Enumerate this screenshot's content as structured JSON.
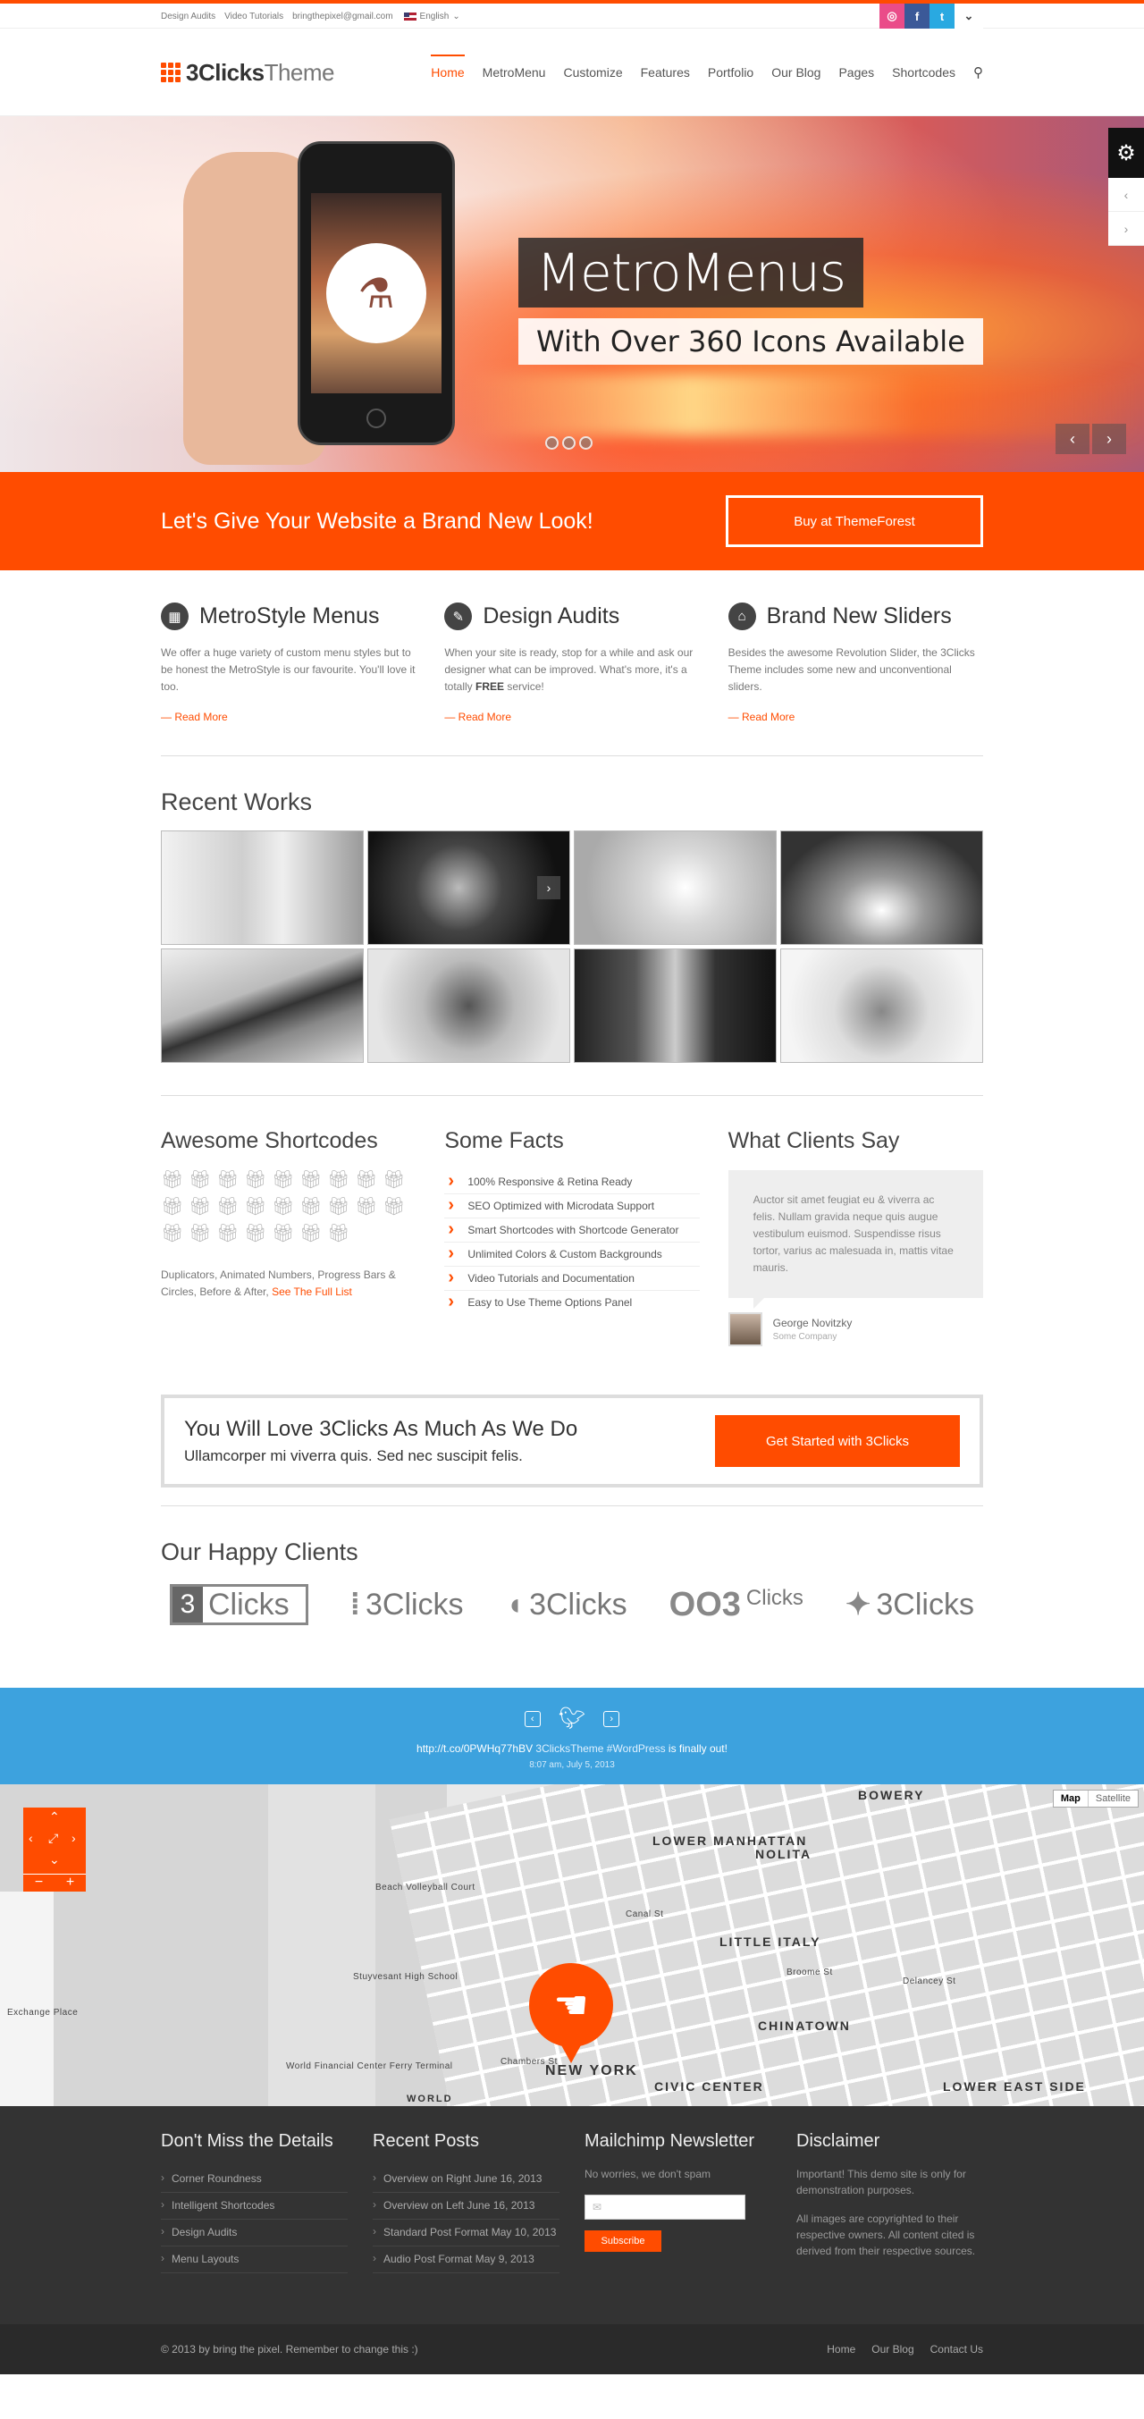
{
  "topbar": {
    "links": [
      "Design Audits",
      "Video Tutorials",
      "bringthepixel@gmail.com"
    ],
    "language": "English",
    "socials": [
      "dribbble-icon",
      "facebook-icon",
      "twitter-icon",
      "chevron-down-icon"
    ]
  },
  "header": {
    "logo_bold": "3Clicks",
    "logo_light": "Theme",
    "nav": [
      "Home",
      "MetroMenu",
      "Customize",
      "Features",
      "Portfolio",
      "Our Blog",
      "Pages",
      "Shortcodes"
    ],
    "active_nav": "Home"
  },
  "hero": {
    "title": "MetroMenus",
    "subtitle": "With Over 360 Icons Available"
  },
  "cta": {
    "message": "Let's Give Your Website a Brand New Look!",
    "button": "Buy at ThemeForest"
  },
  "features": [
    {
      "title": "MetroStyle Menus",
      "text": "We offer a huge variety of custom menu styles but to be honest the MetroStyle is our favourite. You'll love it too.",
      "more": "— Read More",
      "icon": "grid-icon"
    },
    {
      "title": "Design Audits",
      "text_pre": "When your site is ready, stop for a while and ask our designer what can be improved. What's more, it's a totally ",
      "text_bold": "FREE",
      "text_post": " service!",
      "more": "— Read More",
      "icon": "pencil-icon"
    },
    {
      "title": "Brand New Sliders",
      "text": "Besides the awesome Revolution Slider, the 3Clicks Theme includes some new and unconventional sliders.",
      "more": "— Read More",
      "icon": "home-icon"
    }
  ],
  "recent_works": {
    "title": "Recent Works"
  },
  "shortcodes": {
    "title": "Awesome Shortcodes",
    "desc": "Duplicators, Animated Numbers, Progress Bars & Circles, Before & After, ",
    "link": "See The Full List"
  },
  "facts": {
    "title": "Some Facts",
    "items": [
      "100% Responsive & Retina Ready",
      "SEO Optimized with Microdata Support",
      "Smart Shortcodes with Shortcode Generator",
      "Unlimited Colors & Custom Backgrounds",
      "Video Tutorials and Documentation",
      "Easy to Use Theme Options Panel"
    ]
  },
  "testimonial": {
    "title": "What Clients Say",
    "quote": "Auctor sit amet feugiat eu & viverra ac felis. Nullam gravida neque quis augue vestibulum euismod. Suspendisse risus tortor, varius ac malesuada in, mattis vitae mauris.",
    "name": "George Novitzky",
    "company": "Some Company"
  },
  "callout": {
    "title": "You Will Love 3Clicks As Much As We Do",
    "subtitle": "Ullamcorper mi viverra quis. Sed nec suscipit felis.",
    "button": "Get Started with 3Clicks"
  },
  "clients": {
    "title": "Our Happy Clients",
    "logos": [
      "3",
      "Clicks",
      "3Clicks",
      "3Clicks",
      "Clicks",
      "3Clicks"
    ]
  },
  "twitter": {
    "link": "http://t.co/0PWHq77hBV",
    "text_mid": " 3ClicksTheme #WordPress",
    "text_end": " is finally out!",
    "time": "8:07 am, July 5, 2013"
  },
  "map": {
    "type_map": "Map",
    "type_sat": "Satellite",
    "labels": [
      "LOWER MANHATTAN",
      "NOLITA",
      "LITTLE ITALY",
      "CHINATOWN",
      "CIVIC CENTER",
      "NEW YORK",
      "LOWER EAST SIDE",
      "BOWERY",
      "Canal St",
      "Broome St",
      "Delancey St",
      "Chambers St",
      "Beach Volleyball Court",
      "Stuyvesant High School",
      "Exchange Place",
      "World Financial Center Ferry Terminal",
      "WORLD"
    ]
  },
  "footer": {
    "col1": {
      "title": "Don't Miss the Details",
      "items": [
        "Corner Roundness",
        "Intelligent Shortcodes",
        "Design Audits",
        "Menu Layouts"
      ]
    },
    "col2": {
      "title": "Recent Posts",
      "items": [
        "Overview on Right June 16, 2013",
        "Overview on Left June 16, 2013",
        "Standard Post Format May 10, 2013",
        "Audio Post Format May 9, 2013"
      ]
    },
    "col3": {
      "title": "Mailchimp Newsletter",
      "text": "No worries, we don't spam",
      "button": "Subscribe"
    },
    "col4": {
      "title": "Disclaimer",
      "p1": "Important! This demo site is only for demonstration purposes.",
      "p2": "All images are copyrighted to their respective owners. All content cited is derived from their respective sources."
    },
    "copyright": "© 2013 by bring the pixel. Remember to change this :)",
    "links": [
      "Home",
      "Our Blog",
      "Contact Us"
    ]
  },
  "colors": {
    "accent": "#ff4c00",
    "twitter_band": "#3da2de",
    "footer": "#333333"
  }
}
